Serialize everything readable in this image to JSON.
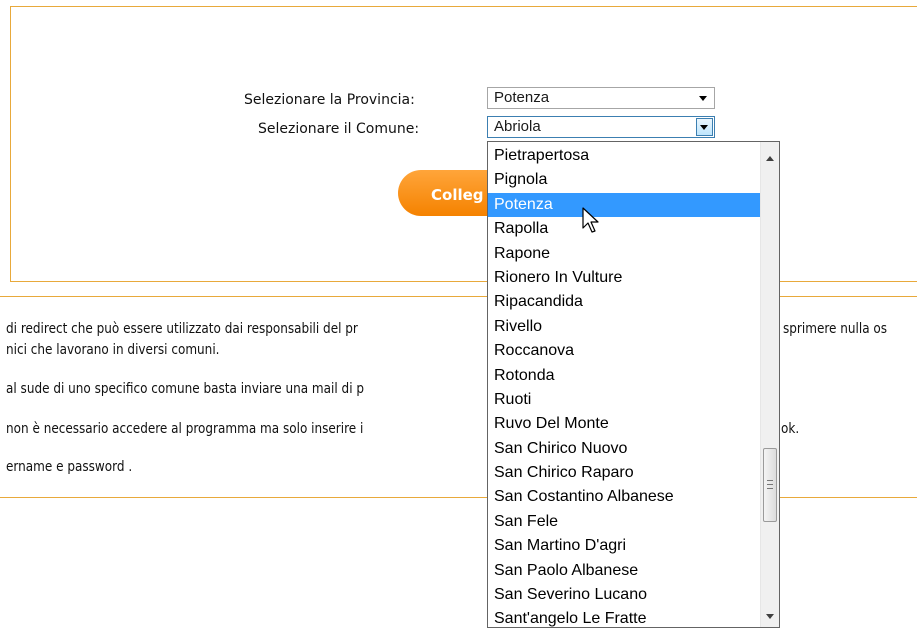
{
  "form": {
    "provincia_label": "Selezionare la Provincia:",
    "provincia_value": "Potenza",
    "comune_label": "Selezionare il Comune:",
    "comune_value": "Abriola",
    "connect_label": "Colleg"
  },
  "info": {
    "lines": [
      "di redirect che può essere utilizzato dai responsabili del pr",
      "nici che lavorano in diversi comuni.",
      "al sude di uno specifico comune basta inviare una mail di p",
      "non è necessario accedere al programma ma solo inserire i",
      "ername e password ."
    ],
    "right_fragments": [
      "sprimere nulla os",
      "ok."
    ]
  },
  "dropdown": {
    "items": [
      "Pietrapertosa",
      "Pignola",
      "Potenza",
      "Rapolla",
      "Rapone",
      "Rionero In Vulture",
      "Ripacandida",
      "Rivello",
      "Roccanova",
      "Rotonda",
      "Ruoti",
      "Ruvo Del Monte",
      "San Chirico Nuovo",
      "San Chirico Raparo",
      "San Costantino Albanese",
      "San Fele",
      "San Martino D'agri",
      "San Paolo Albanese",
      "San Severino Lucano",
      "Sant'angelo Le Fratte"
    ],
    "selected": "Potenza"
  },
  "colors": {
    "accent_orange": "#f58200",
    "border_orange": "#e8a93b",
    "selection_blue": "#3399ff"
  }
}
